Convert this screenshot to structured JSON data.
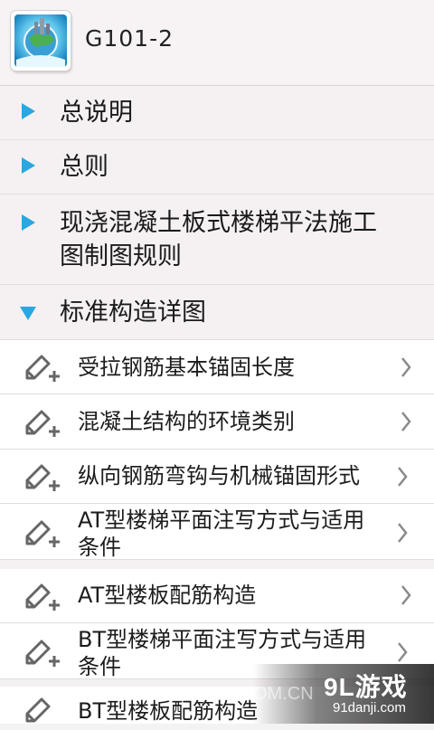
{
  "header": {
    "title": "G101-2",
    "icon": "globe-app-icon"
  },
  "sections": [
    {
      "label": "总说明",
      "expanded": false
    },
    {
      "label": "总则",
      "expanded": false
    },
    {
      "label": "现浇混凝土板式楼梯平法施工图制图规则",
      "line1": "现浇混凝土板式楼梯平法施工",
      "line2": "图制图规则",
      "expanded": false
    },
    {
      "label": "标准构造详图",
      "expanded": true
    }
  ],
  "items": [
    {
      "label": "受拉钢筋基本锚固长度"
    },
    {
      "label": "混凝土结构的环境类别"
    },
    {
      "label": "纵向钢筋弯钩与机械锚固形式"
    },
    {
      "line1": "AT型楼梯平面注写方式与适用",
      "line2": "条件"
    },
    {
      "label": "AT型楼板配筋构造"
    },
    {
      "line1": "BT型楼梯平面注写方式与适用",
      "line2": "条件"
    },
    {
      "label": "BT型楼板配筋构造"
    }
  ],
  "watermark": {
    "text": "OM.CN",
    "logo": "9L游戏",
    "sub": "91danji.com"
  },
  "colors": {
    "accent": "#2aa7e0",
    "text": "#1a1a1a"
  }
}
